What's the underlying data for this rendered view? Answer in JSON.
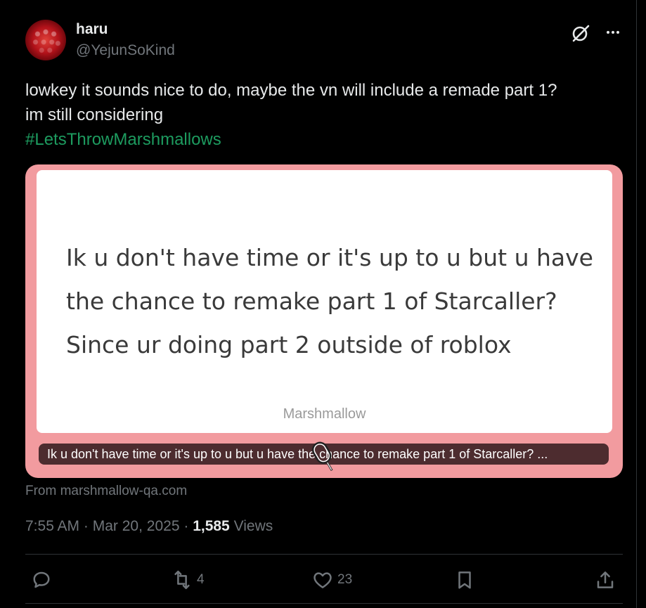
{
  "author": {
    "display_name": "haru",
    "handle": "@YejunSoKind"
  },
  "tweet": {
    "line1": "lowkey it sounds nice to do, maybe the vn will include a remade part 1?",
    "line2": "im still considering",
    "hashtag": "#LetsThrowMarshmallows"
  },
  "card": {
    "question_line1": "Ik u don't have time or it's up to u but u have",
    "question_line2": "the chance to remake part 1 of Starcaller?",
    "question_line3": "Since ur doing part 2 outside of roblox",
    "brand": "Marshmallow",
    "caption": "Ik u don't have time or it's up to u but u have the chance to remake part 1 of Starcaller? ...",
    "background_color": "#f29b9f"
  },
  "source": "From marshmallow-qa.com",
  "meta": {
    "time": "7:55 AM",
    "separator": "·",
    "date": "Mar 20, 2025",
    "views_count": "1,585",
    "views_label": "Views"
  },
  "actions": {
    "reply": {
      "icon": "reply-icon",
      "count": ""
    },
    "retweet": {
      "icon": "retweet-icon",
      "count": "4"
    },
    "like": {
      "icon": "heart-icon",
      "count": "23"
    },
    "bookmark": {
      "icon": "bookmark-icon"
    },
    "share": {
      "icon": "share-icon"
    }
  },
  "colors": {
    "background": "#000000",
    "text_primary": "#e7e9ea",
    "text_secondary": "#71767b",
    "hashtag": "#1d9b5f",
    "divider": "#2f3336"
  }
}
